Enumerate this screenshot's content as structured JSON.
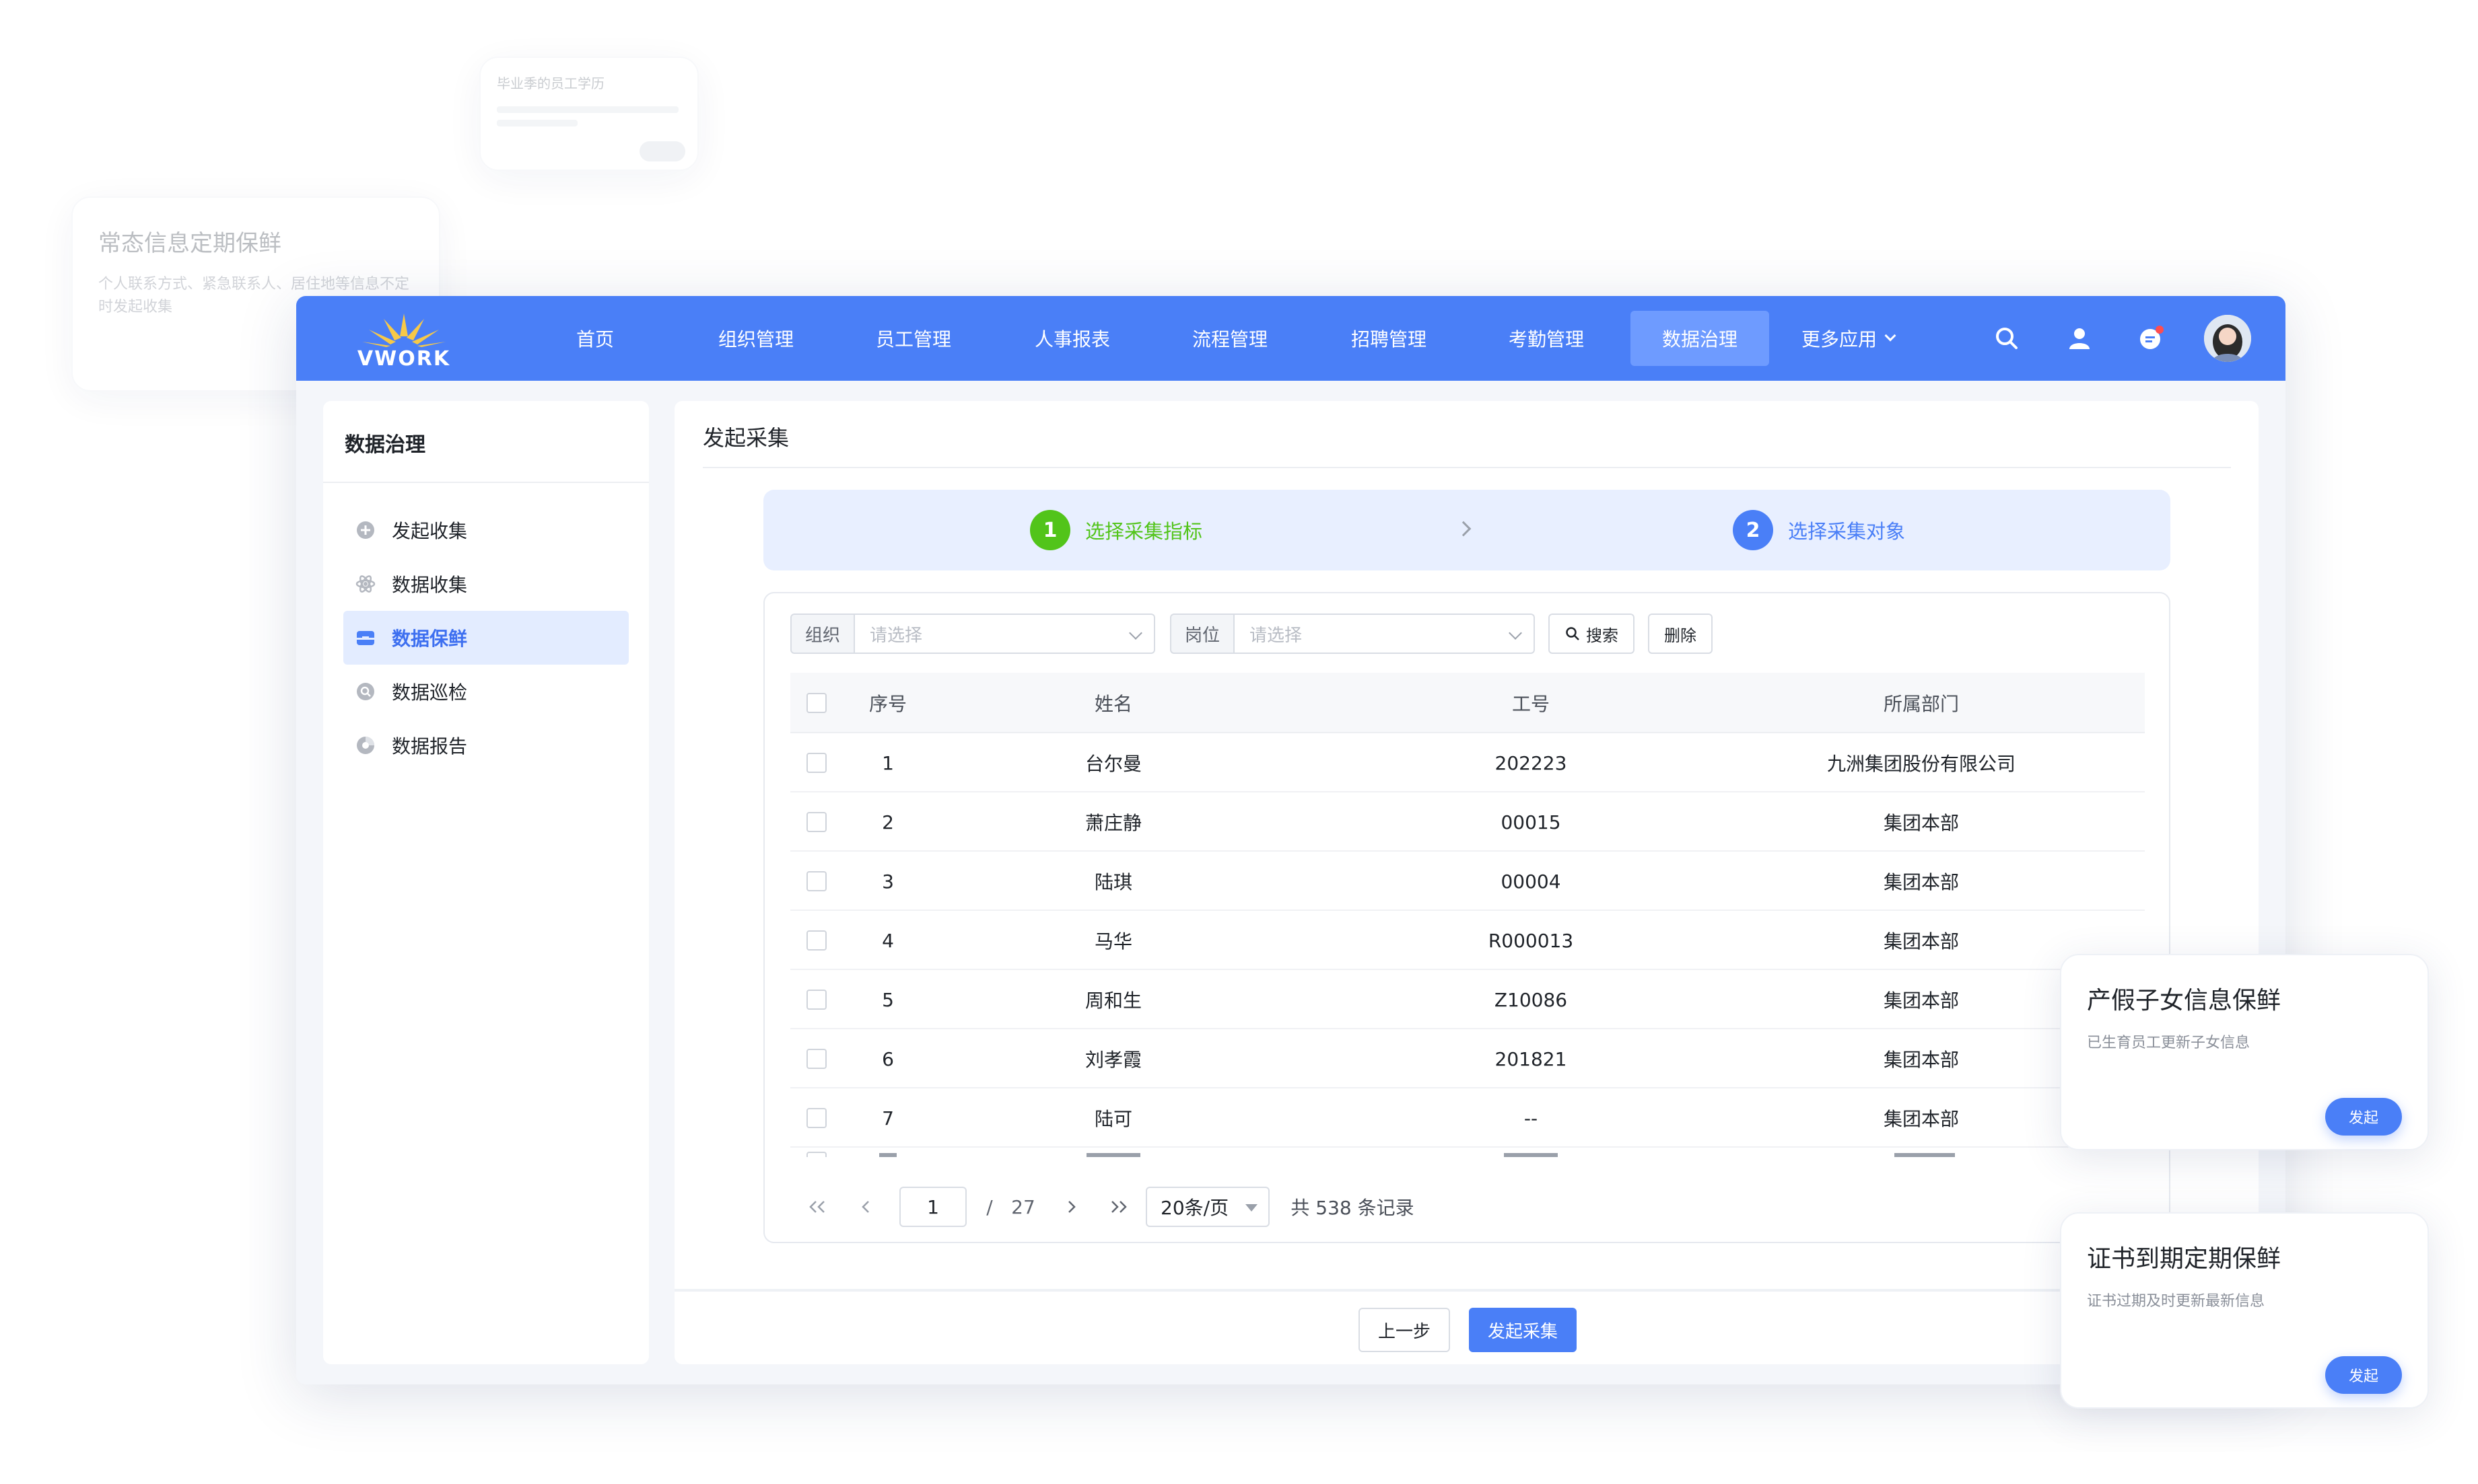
{
  "bg_cards": {
    "top_small": {
      "title": "毕业季的员工学历"
    },
    "left": {
      "title": "常态信息定期保鲜",
      "desc": "个人联系方式、紧急联系人、居住地等信息不定时发起收集"
    }
  },
  "float_cards": [
    {
      "title": "产假子女信息保鲜",
      "desc": "已生育员工更新子女信息",
      "button": "发起"
    },
    {
      "title": "证书到期定期保鲜",
      "desc": "证书过期及时更新最新信息",
      "button": "发起"
    }
  ],
  "topbar": {
    "logo_text": "VWORK",
    "nav": [
      "首页",
      "组织管理",
      "员工管理",
      "人事报表",
      "流程管理",
      "招聘管理",
      "考勤管理",
      "数据治理",
      "更多应用"
    ],
    "active_nav": "数据治理"
  },
  "sidebar": {
    "title": "数据治理",
    "items": [
      {
        "label": "发起收集",
        "icon": "plus-circle-icon"
      },
      {
        "label": "数据收集",
        "icon": "atom-icon"
      },
      {
        "label": "数据保鲜",
        "icon": "inbox-icon"
      },
      {
        "label": "数据巡检",
        "icon": "search-circle-icon"
      },
      {
        "label": "数据报告",
        "icon": "pie-chart-icon"
      }
    ],
    "active": "数据保鲜"
  },
  "content": {
    "title": "发起采集",
    "steps": [
      {
        "num": "1",
        "label": "选择采集指标",
        "color": "#52c41a"
      },
      {
        "num": "2",
        "label": "选择采集对象",
        "color": "#4a7ff7"
      }
    ],
    "filters": {
      "org_label": "组织",
      "org_placeholder": "请选择",
      "post_label": "岗位",
      "post_placeholder": "请选择",
      "search_btn": "搜索",
      "delete_btn": "删除"
    },
    "table": {
      "headers": [
        "序号",
        "姓名",
        "工号",
        "所属部门"
      ],
      "rows": [
        [
          "1",
          "台尔曼",
          "202223",
          "九洲集团股份有限公司"
        ],
        [
          "2",
          "萧庄静",
          "00015",
          "集团本部"
        ],
        [
          "3",
          "陆琪",
          "00004",
          "集团本部"
        ],
        [
          "4",
          "马华",
          "R000013",
          "集团本部"
        ],
        [
          "5",
          "周和生",
          "Z10086",
          "集团本部"
        ],
        [
          "6",
          "刘孝霞",
          "201821",
          "集团本部"
        ],
        [
          "7",
          "陆可",
          "--",
          "集团本部"
        ]
      ]
    },
    "pagination": {
      "current": "1",
      "separator": "/",
      "total_pages": "27",
      "page_size": "20条/页",
      "total_text": "共 538 条记录"
    },
    "footer": {
      "prev": "上一步",
      "submit": "发起采集"
    }
  },
  "colors": {
    "brand": "#4a7ff7",
    "step_done": "#52c41a"
  }
}
